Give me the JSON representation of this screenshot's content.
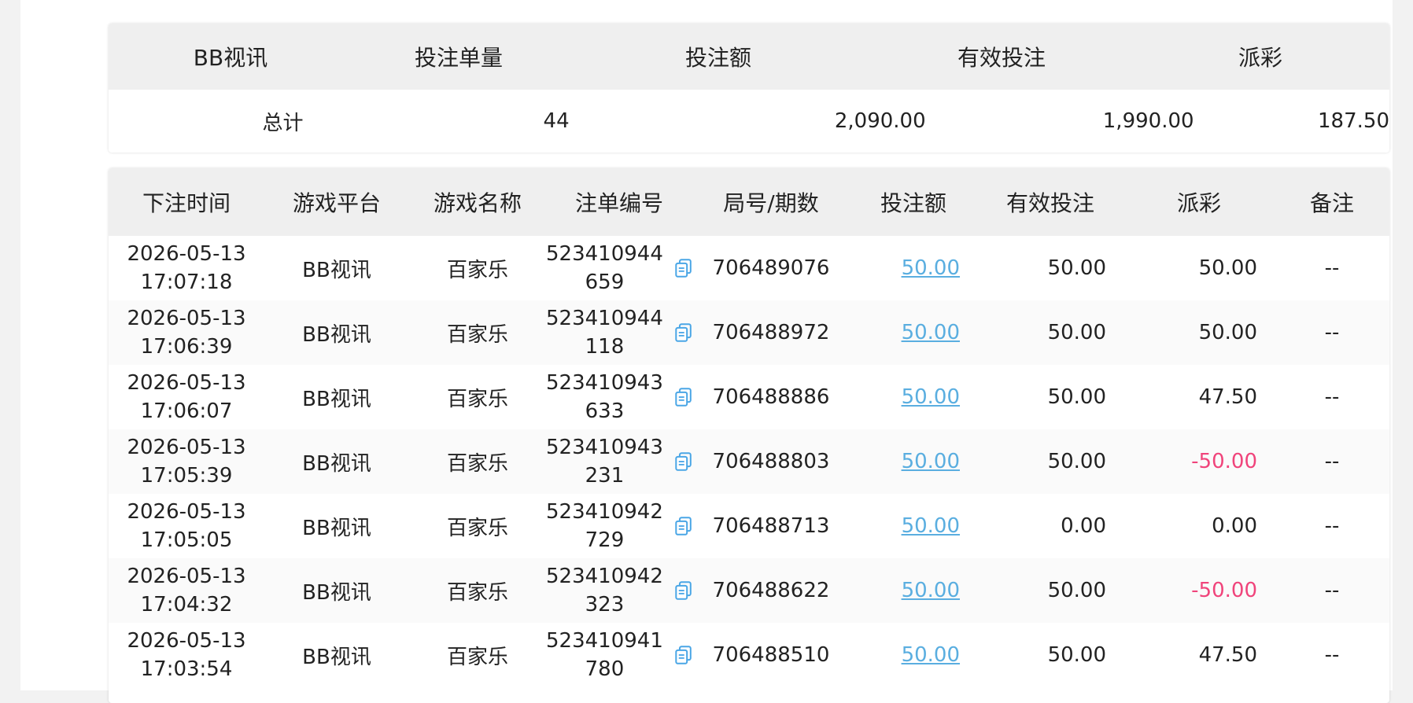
{
  "summary": {
    "headers": [
      "BB视讯",
      "投注单量",
      "投注额",
      "有效投注",
      "派彩"
    ],
    "total_label": "总计",
    "bet_count": "44",
    "bet_amount": "2,090.00",
    "valid_bet": "1,990.00",
    "payout": "187.50"
  },
  "table": {
    "headers": [
      "下注时间",
      "游戏平台",
      "游戏名称",
      "注单编号",
      "局号/期数",
      "投注额",
      "有效投注",
      "派彩",
      "备注"
    ],
    "rows": [
      {
        "date": "2026-05-13",
        "time": "17:07:18",
        "platform": "BB视讯",
        "game": "百家乐",
        "order_a": "523410944",
        "order_b": "659",
        "round": "706489076",
        "bet": "50.00",
        "valid": "50.00",
        "payout": "50.00",
        "payout_negative": false,
        "note": "--"
      },
      {
        "date": "2026-05-13",
        "time": "17:06:39",
        "platform": "BB视讯",
        "game": "百家乐",
        "order_a": "523410944",
        "order_b": "118",
        "round": "706488972",
        "bet": "50.00",
        "valid": "50.00",
        "payout": "50.00",
        "payout_negative": false,
        "note": "--"
      },
      {
        "date": "2026-05-13",
        "time": "17:06:07",
        "platform": "BB视讯",
        "game": "百家乐",
        "order_a": "523410943",
        "order_b": "633",
        "round": "706488886",
        "bet": "50.00",
        "valid": "50.00",
        "payout": "47.50",
        "payout_negative": false,
        "note": "--"
      },
      {
        "date": "2026-05-13",
        "time": "17:05:39",
        "platform": "BB视讯",
        "game": "百家乐",
        "order_a": "523410943",
        "order_b": "231",
        "round": "706488803",
        "bet": "50.00",
        "valid": "50.00",
        "payout": "-50.00",
        "payout_negative": true,
        "note": "--"
      },
      {
        "date": "2026-05-13",
        "time": "17:05:05",
        "platform": "BB视讯",
        "game": "百家乐",
        "order_a": "523410942",
        "order_b": "729",
        "round": "706488713",
        "bet": "50.00",
        "valid": "0.00",
        "payout": "0.00",
        "payout_negative": false,
        "note": "--"
      },
      {
        "date": "2026-05-13",
        "time": "17:04:32",
        "platform": "BB视讯",
        "game": "百家乐",
        "order_a": "523410942",
        "order_b": "323",
        "round": "706488622",
        "bet": "50.00",
        "valid": "50.00",
        "payout": "-50.00",
        "payout_negative": true,
        "note": "--"
      },
      {
        "date": "2026-05-13",
        "time": "17:03:54",
        "platform": "BB视讯",
        "game": "百家乐",
        "order_a": "523410941",
        "order_b": "780",
        "round": "706488510",
        "bet": "50.00",
        "valid": "50.00",
        "payout": "47.50",
        "payout_negative": false,
        "note": "--"
      }
    ]
  },
  "colors": {
    "link": "#5aaee0",
    "negative": "#f0447b",
    "copy_icon": "#4aa6e6"
  },
  "icons": {
    "copy": "copy-icon"
  }
}
